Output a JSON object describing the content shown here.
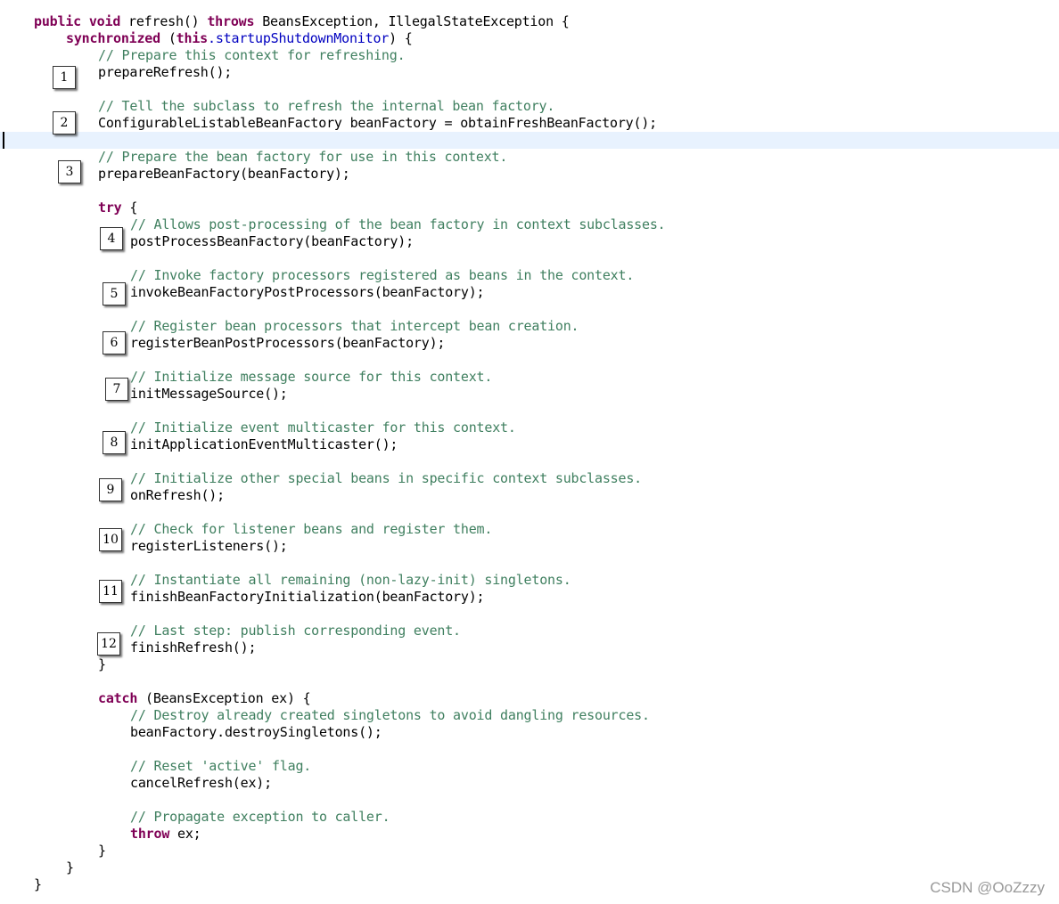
{
  "code": {
    "signature": {
      "kw1": "public",
      "kw2": "void",
      "name": "refresh()",
      "kw3": "throws",
      "exceptions": "BeansException, IllegalStateException {"
    },
    "sync": {
      "kw": "synchronized",
      "open": "(",
      "this": "this",
      "field": ".startupShutdownMonitor",
      "close": ") {"
    },
    "comments": {
      "c1": "// Prepare this context for refreshing.",
      "c2": "// Tell the subclass to refresh the internal bean factory.",
      "c3": "// Prepare the bean factory for use in this context.",
      "c4": "// Allows post-processing of the bean factory in context subclasses.",
      "c5": "// Invoke factory processors registered as beans in the context.",
      "c6": "// Register bean processors that intercept bean creation.",
      "c7": "// Initialize message source for this context.",
      "c8": "// Initialize event multicaster for this context.",
      "c9": "// Initialize other special beans in specific context subclasses.",
      "c10": "// Check for listener beans and register them.",
      "c11": "// Instantiate all remaining (non-lazy-init) singletons.",
      "c12": "// Last step: publish corresponding event.",
      "c13": "// Destroy already created singletons to avoid dangling resources.",
      "c14": "// Reset 'active' flag.",
      "c15": "// Propagate exception to caller."
    },
    "statements": {
      "s1": "prepareRefresh();",
      "s2": "ConfigurableListableBeanFactory beanFactory = obtainFreshBeanFactory();",
      "s3": "prepareBeanFactory(beanFactory);",
      "s4": "postProcessBeanFactory(beanFactory);",
      "s5": "invokeBeanFactoryPostProcessors(beanFactory);",
      "s6": "registerBeanPostProcessors(beanFactory);",
      "s7": "initMessageSource();",
      "s8": "initApplicationEventMulticaster();",
      "s9": "onRefresh();",
      "s10": "registerListeners();",
      "s11": "finishBeanFactoryInitialization(beanFactory);",
      "s12": "finishRefresh();",
      "s13": "beanFactory.destroySingletons();",
      "s14": "cancelRefresh(ex);",
      "s15": "ex;"
    },
    "try": {
      "kw": "try",
      "open": " {",
      "close": "}"
    },
    "catch": {
      "kw": "catch",
      "rest": " (BeansException ex) {"
    },
    "throw_kw": "throw",
    "close_brace": "}"
  },
  "badges": [
    "1",
    "2",
    "3",
    "4",
    "5",
    "6",
    "7",
    "8",
    "9",
    "10",
    "11",
    "12"
  ],
  "watermark": "CSDN @OoZzzy",
  "colors": {
    "keyword": "#7f0055",
    "comment": "#3f7f5f",
    "field": "#0000c0",
    "current_line": "#e8f2fe"
  }
}
